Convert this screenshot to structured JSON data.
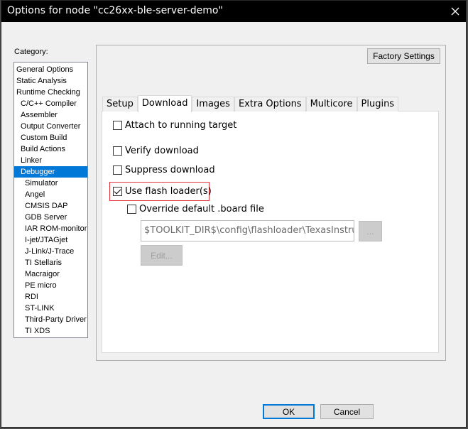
{
  "window": {
    "title": "Options for node \"cc26xx-ble-server-demo\"",
    "close_glyph": "✕"
  },
  "category": {
    "label": "Category:",
    "items": [
      {
        "label": "General Options",
        "level": 0
      },
      {
        "label": "Static Analysis",
        "level": 0
      },
      {
        "label": "Runtime Checking",
        "level": 0
      },
      {
        "label": "C/C++ Compiler",
        "level": 1
      },
      {
        "label": "Assembler",
        "level": 1
      },
      {
        "label": "Output Converter",
        "level": 1
      },
      {
        "label": "Custom Build",
        "level": 1
      },
      {
        "label": "Build Actions",
        "level": 1
      },
      {
        "label": "Linker",
        "level": 1
      },
      {
        "label": "Debugger",
        "level": 1,
        "selected": true
      },
      {
        "label": "Simulator",
        "level": 2
      },
      {
        "label": "Angel",
        "level": 2
      },
      {
        "label": "CMSIS DAP",
        "level": 2
      },
      {
        "label": "GDB Server",
        "level": 2
      },
      {
        "label": "IAR ROM-monitor",
        "level": 2
      },
      {
        "label": "I-jet/JTAGjet",
        "level": 2
      },
      {
        "label": "J-Link/J-Trace",
        "level": 2
      },
      {
        "label": "TI Stellaris",
        "level": 2
      },
      {
        "label": "Macraigor",
        "level": 2
      },
      {
        "label": "PE micro",
        "level": 2
      },
      {
        "label": "RDI",
        "level": 2
      },
      {
        "label": "ST-LINK",
        "level": 2
      },
      {
        "label": "Third-Party Driver",
        "level": 2
      },
      {
        "label": "TI XDS",
        "level": 2
      }
    ]
  },
  "factory_settings_label": "Factory Settings",
  "tabs": [
    {
      "label": "Setup",
      "active": false
    },
    {
      "label": "Download",
      "active": true
    },
    {
      "label": "Images",
      "active": false
    },
    {
      "label": "Extra Options",
      "active": false
    },
    {
      "label": "Multicore",
      "active": false
    },
    {
      "label": "Plugins",
      "active": false
    }
  ],
  "download": {
    "attach_label": "Attach to running target",
    "attach_checked": false,
    "verify_label": "Verify download",
    "verify_checked": false,
    "suppress_label": "Suppress download",
    "suppress_checked": false,
    "flash_loader_label": "Use flash loader(s)",
    "flash_loader_checked": true,
    "override_label": "Override default .board file",
    "override_checked": false,
    "board_path": "$TOOLKIT_DIR$\\config\\flashloader\\TexasInstrumen",
    "browse_label": "...",
    "edit_label": "Edit..."
  },
  "footer": {
    "ok_label": "OK",
    "cancel_label": "Cancel"
  },
  "colors": {
    "selection": "#0078d7",
    "highlight_box": "#e0303a"
  }
}
